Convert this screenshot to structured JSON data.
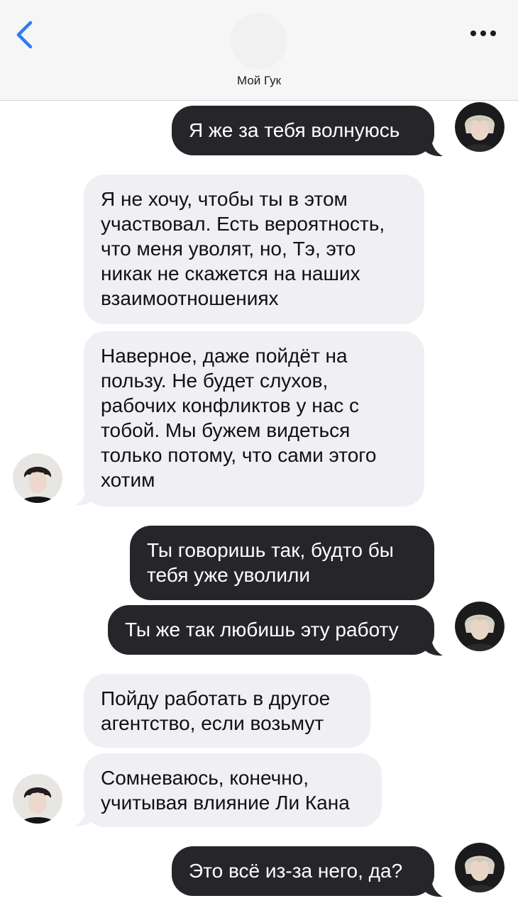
{
  "header": {
    "contact_name": "Мой Гук",
    "back_icon": "chevron-left-icon",
    "more_icon": "ellipsis-icon",
    "accent": "#2f7bf6"
  },
  "messages": [
    {
      "side": "out",
      "text": "Я же за тебя волнуюсь"
    },
    {
      "side": "in",
      "text": "Я не хочу, чтобы ты в этом участвовал. Есть вероятность, что меня уволят, но, Тэ, это никак не скажется на наших взаимоотношениях"
    },
    {
      "side": "in",
      "text": "Наверное, даже пойдёт на пользу. Не будет слухов, рабочих конфликтов у нас с тобой. Мы бужем видеться только потому, что сами этого хотим"
    },
    {
      "side": "out",
      "text": "Ты говоришь так, будто бы тебя уже уволили"
    },
    {
      "side": "out",
      "text": "Ты же так любишь эту работу"
    },
    {
      "side": "in",
      "text": "Пойду работать в другое агентство, если возьмут"
    },
    {
      "side": "in",
      "text": "Сомневаюсь, конечно, учитывая влияние Ли Кана"
    },
    {
      "side": "out",
      "text": "Это всё из-за него, да?"
    }
  ],
  "colors": {
    "outgoing_bubble": "#26262a",
    "incoming_bubble": "#efeff4",
    "header_bg": "#f6f6f7"
  }
}
